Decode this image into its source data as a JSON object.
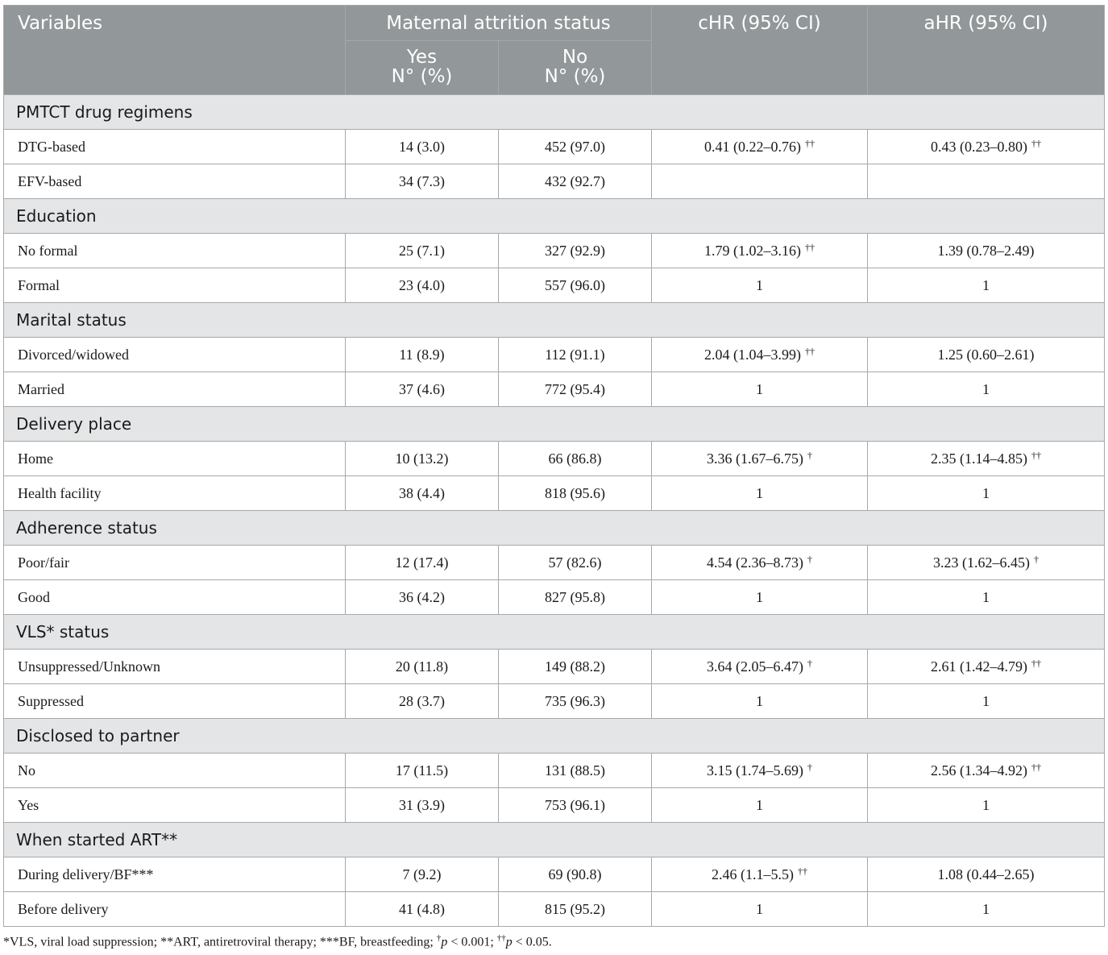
{
  "header": {
    "variables": "Variables",
    "status_group": "Maternal attrition status",
    "yes_line1": "Yes",
    "yes_line2": "N° (%)",
    "no_line1": "No",
    "no_line2": "N° (%)",
    "chr": "cHR (95% CI)",
    "ahr": "aHR (95% CI)"
  },
  "groups": [
    {
      "title": "PMTCT drug regimens",
      "rows": [
        {
          "label": "DTG-based",
          "yes": "14 (3.0)",
          "no": "452 (97.0)",
          "chr": "0.41 (0.22–0.76)",
          "chr_mark": "††",
          "ahr": "0.43 (0.23–0.80)",
          "ahr_mark": "††"
        },
        {
          "label": "EFV-based",
          "yes": "34 (7.3)",
          "no": "432 (92.7)",
          "chr": "",
          "chr_mark": "",
          "ahr": "",
          "ahr_mark": ""
        }
      ]
    },
    {
      "title": "Education",
      "rows": [
        {
          "label": "No formal",
          "yes": "25 (7.1)",
          "no": "327 (92.9)",
          "chr": "1.79 (1.02–3.16)",
          "chr_mark": "††",
          "ahr": "1.39 (0.78–2.49)",
          "ahr_mark": ""
        },
        {
          "label": "Formal",
          "yes": "23 (4.0)",
          "no": "557 (96.0)",
          "chr": "1",
          "chr_mark": "",
          "ahr": "1",
          "ahr_mark": ""
        }
      ]
    },
    {
      "title": "Marital status",
      "rows": [
        {
          "label": "Divorced/widowed",
          "yes": "11 (8.9)",
          "no": "112 (91.1)",
          "chr": "2.04 (1.04–3.99)",
          "chr_mark": "††",
          "ahr": "1.25 (0.60–2.61)",
          "ahr_mark": ""
        },
        {
          "label": "Married",
          "yes": "37 (4.6)",
          "no": "772 (95.4)",
          "chr": "1",
          "chr_mark": "",
          "ahr": "1",
          "ahr_mark": ""
        }
      ]
    },
    {
      "title": "Delivery place",
      "rows": [
        {
          "label": "Home",
          "yes": "10 (13.2)",
          "no": "66 (86.8)",
          "chr": "3.36 (1.67–6.75)",
          "chr_mark": "†",
          "ahr": "2.35 (1.14–4.85)",
          "ahr_mark": "††"
        },
        {
          "label": "Health facility",
          "yes": "38 (4.4)",
          "no": "818 (95.6)",
          "chr": "1",
          "chr_mark": "",
          "ahr": "1",
          "ahr_mark": ""
        }
      ]
    },
    {
      "title": "Adherence status",
      "rows": [
        {
          "label": "Poor/fair",
          "yes": "12 (17.4)",
          "no": "57 (82.6)",
          "chr": "4.54 (2.36–8.73)",
          "chr_mark": "†",
          "ahr": "3.23 (1.62–6.45)",
          "ahr_mark": "†"
        },
        {
          "label": "Good",
          "yes": "36 (4.2)",
          "no": "827 (95.8)",
          "chr": "1",
          "chr_mark": "",
          "ahr": "1",
          "ahr_mark": ""
        }
      ]
    },
    {
      "title": "VLS* status",
      "rows": [
        {
          "label": "Unsuppressed/Unknown",
          "yes": "20 (11.8)",
          "no": "149 (88.2)",
          "chr": "3.64 (2.05–6.47)",
          "chr_mark": "†",
          "ahr": "2.61 (1.42–4.79)",
          "ahr_mark": "††"
        },
        {
          "label": "Suppressed",
          "yes": "28 (3.7)",
          "no": "735 (96.3)",
          "chr": "1",
          "chr_mark": "",
          "ahr": "1",
          "ahr_mark": ""
        }
      ]
    },
    {
      "title": "Disclosed to partner",
      "rows": [
        {
          "label": "No",
          "yes": "17 (11.5)",
          "no": "131 (88.5)",
          "chr": "3.15 (1.74–5.69)",
          "chr_mark": "†",
          "ahr": "2.56 (1.34–4.92)",
          "ahr_mark": "††"
        },
        {
          "label": "Yes",
          "yes": "31 (3.9)",
          "no": "753 (96.1)",
          "chr": "1",
          "chr_mark": "",
          "ahr": "1",
          "ahr_mark": ""
        }
      ]
    },
    {
      "title": "When started ART**",
      "rows": [
        {
          "label": "During delivery/BF***",
          "yes": "7 (9.2)",
          "no": "69 (90.8)",
          "chr": "2.46 (1.1–5.5)",
          "chr_mark": "††",
          "ahr": "1.08 (0.44–2.65)",
          "ahr_mark": ""
        },
        {
          "label": "Before delivery",
          "yes": "41 (4.8)",
          "no": "815 (95.2)",
          "chr": "1",
          "chr_mark": "",
          "ahr": "1",
          "ahr_mark": ""
        }
      ]
    }
  ],
  "footnote": {
    "vls": "*VLS, viral load suppression; ",
    "art": "**ART, antiretroviral therapy; ",
    "bf": "***BF, breastfeeding; ",
    "mark1": "†",
    "p_symbol": "p",
    "p1_text": " < 0.001; ",
    "mark2": "††",
    "p2_text": " < 0.05."
  }
}
